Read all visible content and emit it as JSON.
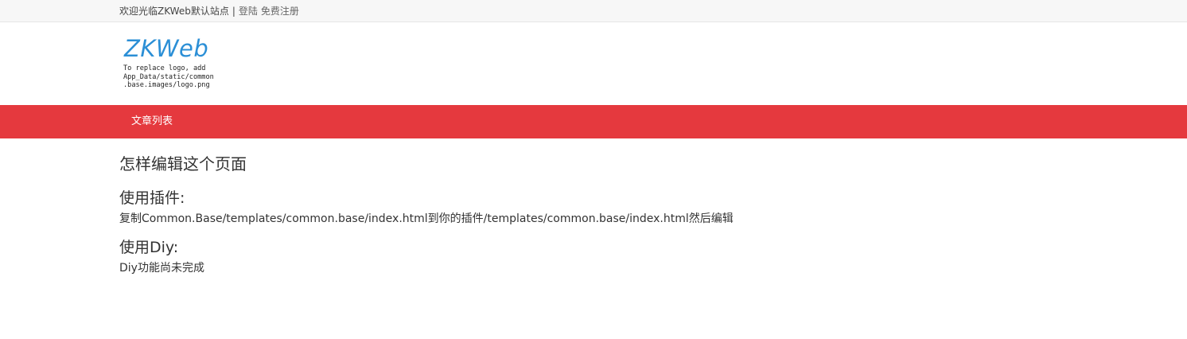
{
  "topbar": {
    "welcome": "欢迎光临ZKWeb默认站点",
    "separator": "|",
    "login": "登陆",
    "register": "免费注册"
  },
  "logo": {
    "wordmark": "ZKWeb",
    "note": "To replace logo, add\nApp_Data/static/common\n.base.images/logo.png"
  },
  "nav": {
    "items": [
      {
        "label": "文章列表"
      }
    ]
  },
  "main": {
    "title": "怎样编辑这个页面",
    "sections": [
      {
        "heading": "使用插件:",
        "text": "复制Common.Base/templates/common.base/index.html到你的插件/templates/common.base/index.html然后编辑"
      },
      {
        "heading": "使用Diy:",
        "text": "Diy功能尚未完成"
      }
    ]
  },
  "colors": {
    "nav_background": "#e5393e",
    "topbar_background": "#f7f7f7",
    "logo_blue": "#2b8fd6"
  }
}
